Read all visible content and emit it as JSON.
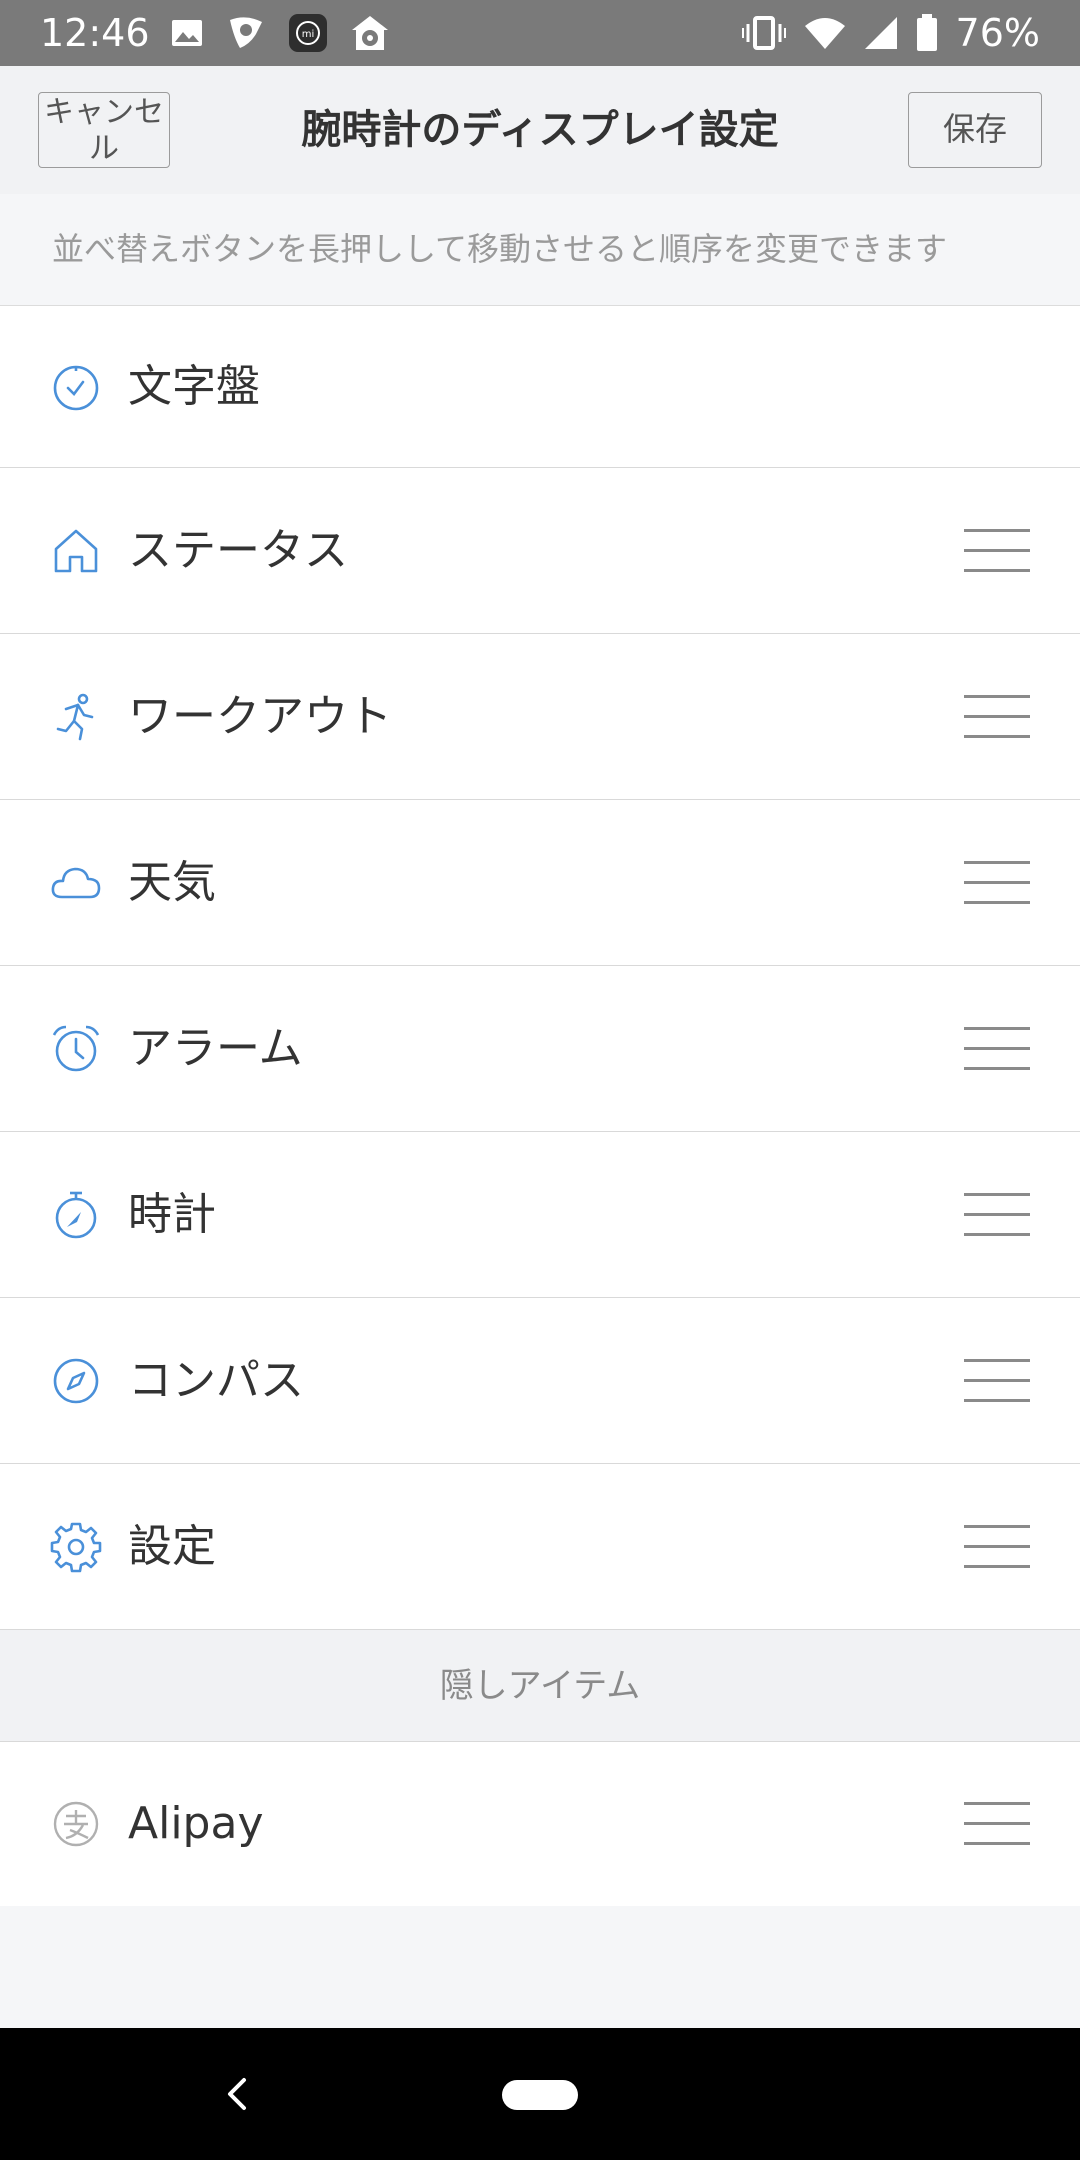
{
  "status_bar": {
    "time": "12:46",
    "left_icons": [
      "image-icon",
      "gear-shield-icon",
      "mi-fit-icon",
      "soccer-house-icon"
    ],
    "right_icons": [
      "vibrate-icon",
      "wifi-icon",
      "signal-icon",
      "battery-icon"
    ],
    "battery": "76%"
  },
  "header": {
    "cancel_label": "キャンセル",
    "title": "腕時計のディスプレイ設定",
    "save_label": "保存"
  },
  "hint": "並べ替えボタンを長押しして移動させると順序を変更できます",
  "items": [
    {
      "label": "文字盤",
      "icon": "clock-face-icon",
      "draggable": false
    },
    {
      "label": "ステータス",
      "icon": "home-icon",
      "draggable": true
    },
    {
      "label": "ワークアウト",
      "icon": "running-icon",
      "draggable": true
    },
    {
      "label": "天気",
      "icon": "cloud-icon",
      "draggable": true
    },
    {
      "label": "アラーム",
      "icon": "alarm-clock-icon",
      "draggable": true
    },
    {
      "label": "時計",
      "icon": "stopwatch-icon",
      "draggable": true
    },
    {
      "label": "コンパス",
      "icon": "compass-icon",
      "draggable": true
    },
    {
      "label": "設定",
      "icon": "gear-icon",
      "draggable": true
    }
  ],
  "hidden_section_title": "隠しアイテム",
  "hidden_items": [
    {
      "label": "Alipay",
      "icon": "alipay-icon",
      "draggable": true
    }
  ],
  "colors": {
    "accent_icon": "#4a90d9",
    "muted_icon": "#b0b0b0",
    "status_bar": "#7a7a7a"
  }
}
